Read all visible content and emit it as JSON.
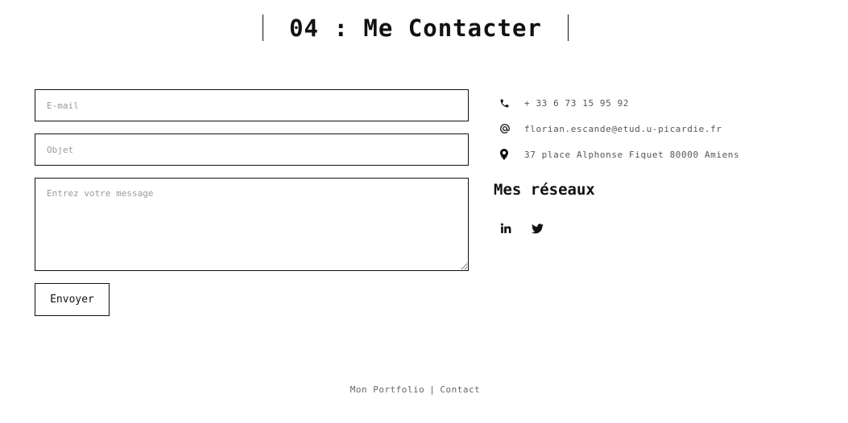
{
  "section": {
    "title": "04 : Me Contacter"
  },
  "form": {
    "email_placeholder": "E-mail",
    "subject_placeholder": "Objet",
    "message_placeholder": "Entrez votre message",
    "submit_label": "Envoyer"
  },
  "contact": {
    "phone": "+ 33 6 73 15 95 92",
    "email": "florian.escande@etud.u-picardie.fr",
    "address": "37 place Alphonse Fiquet 80000 Amiens",
    "phone_icon": "phone-icon",
    "email_icon": "at-icon",
    "address_icon": "map-marker-icon"
  },
  "networks": {
    "title": "Mes réseaux",
    "items": [
      {
        "icon": "linkedin-icon"
      },
      {
        "icon": "twitter-icon"
      }
    ]
  },
  "footer": {
    "link_portfolio": "Mon Portfolio",
    "separator": "|",
    "link_contact": "Contact"
  }
}
